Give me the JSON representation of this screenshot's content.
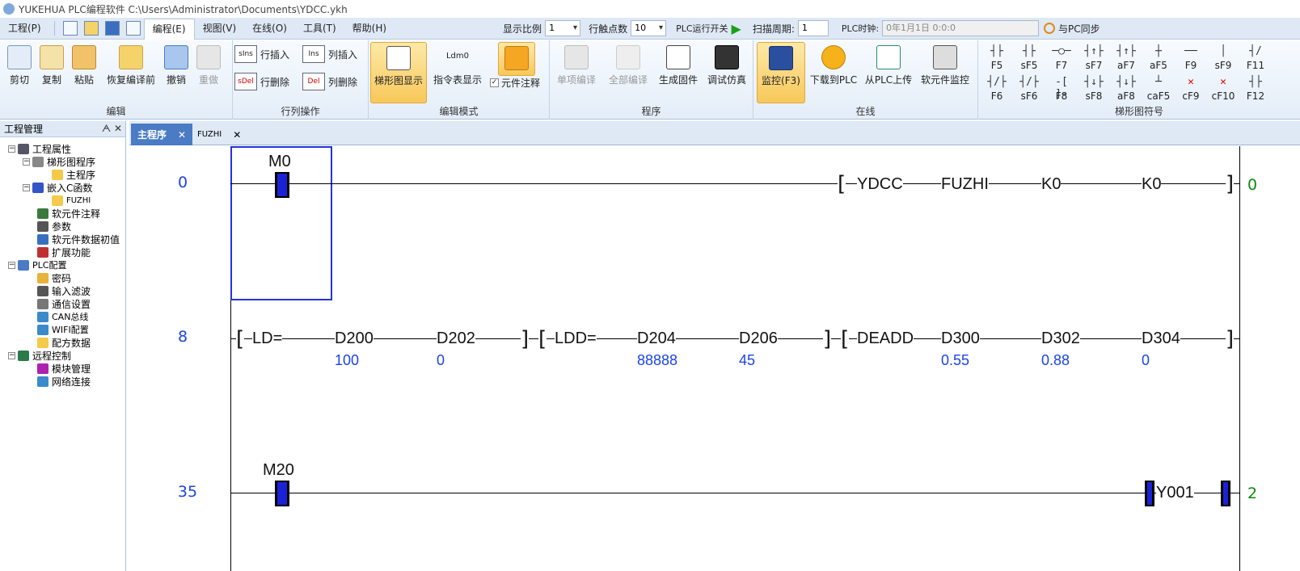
{
  "title": "YUKEHUA PLC编程软件 C:\\Users\\Administrator\\Documents\\YDCC.ykh",
  "menus": [
    "工程(P)",
    "编程(E)",
    "视图(V)",
    "在线(O)",
    "工具(T)",
    "帮助(H)"
  ],
  "toolbar": {
    "scale_label": "显示比例",
    "scale_value": "1",
    "contacts_label": "行触点数",
    "contacts_value": "10",
    "plc_switch_label": "PLC运行开关",
    "scan_label": "扫描周期:",
    "scan_value": "1",
    "clock_label": "PLC时钟:",
    "clock_value": "0年1月1日 0:0:0",
    "sync_label": "与PC同步"
  },
  "ribbon": {
    "edit": {
      "label": "编辑",
      "buttons": [
        "剪切",
        "复制",
        "粘贴",
        "恢复编译前",
        "撤销",
        "重做"
      ]
    },
    "rowcol": {
      "label": "行列操作",
      "row_insert": "行插入",
      "row_delete": "行删除",
      "col_insert": "列插入",
      "col_delete": "列删除",
      "ins_icon": "sIns",
      "del_icon": "sDel",
      "cins_icon": "Ins",
      "cdel_icon": "Del"
    },
    "mode": {
      "label": "编辑模式",
      "ladder": "梯形图显示",
      "inst": "指令表显示",
      "inst_icon": "Ldm0",
      "comment": "元件注释"
    },
    "program": {
      "label": "程序",
      "buttons": [
        "单项编译",
        "全部编译",
        "生成固件",
        "调试仿真"
      ]
    },
    "online": {
      "label": "在线",
      "buttons": [
        "监控(F3)",
        "下载到PLC",
        "从PLC上传",
        "软元件监控"
      ]
    },
    "ladder": {
      "label": "梯形图符号",
      "row1": [
        "F5",
        "sF5",
        "F7",
        "sF7",
        "aF7",
        "aF5",
        "F9",
        "sF9",
        "F11"
      ],
      "row2": [
        "F6",
        "sF6",
        "F8",
        "sF8",
        "aF8",
        "caF5",
        "cF9",
        "cF10",
        "F12"
      ]
    }
  },
  "panel": {
    "title": "工程管理",
    "nodes": [
      "工程属性",
      "梯形图程序",
      "主程序",
      "嵌入C函数",
      "FUZHI",
      "软元件注释",
      "参数",
      "软元件数据初值",
      "扩展功能",
      "PLC配置",
      "密码",
      "输入滤波",
      "通信设置",
      "CAN总线",
      "WIFI配置",
      "配方数据",
      "远程控制",
      "模块管理",
      "网络连接"
    ]
  },
  "tabs": [
    "主程序",
    "FUZHI"
  ],
  "ladder": {
    "rung0": {
      "step": "0",
      "contact": "M0",
      "inst": [
        "YDCC",
        "FUZHI",
        "K0",
        "K0"
      ],
      "end": "0"
    },
    "rung1": {
      "step": "8",
      "g1": {
        "op": "LD=",
        "a": "D200",
        "b": "D202",
        "av": "100",
        "bv": "0"
      },
      "g2": {
        "op": "LDD=",
        "a": "D204",
        "b": "D206",
        "av": "88888",
        "bv": "45"
      },
      "g3": {
        "op": "DEADD",
        "a": "D300",
        "b": "D302",
        "c": "D304",
        "av": "0.55",
        "bv": "0.88",
        "cv": "0"
      }
    },
    "rung2": {
      "step": "35",
      "contact": "M20",
      "coil": "Y001",
      "end": "2"
    }
  }
}
